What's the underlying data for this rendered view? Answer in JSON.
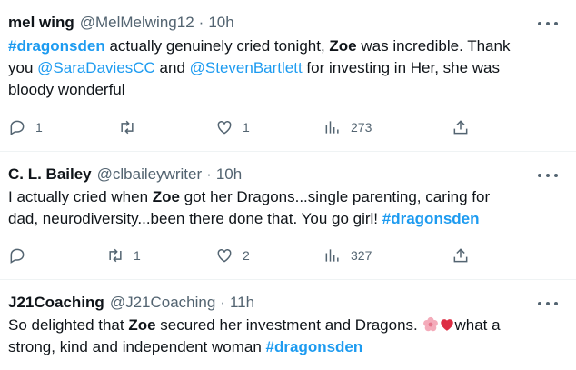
{
  "tweets": [
    {
      "name": "mel wing",
      "handle": "@MelMelwing12",
      "time": "10h",
      "text_parts": [
        "#dragonsden",
        " actually genuinely cried tonight, ",
        "Zoe",
        " was incredible. Thank",
        "you ",
        "@SaraDaviesCC",
        " and ",
        "@StevenBartlett",
        " for investing in Her, she was",
        "bloody wonderful"
      ],
      "replies": "1",
      "retweets": "",
      "likes": "1",
      "views": "273"
    },
    {
      "name": "C. L. Bailey",
      "handle": "@clbaileywriter",
      "time": "10h",
      "text_parts": [
        "I actually cried when ",
        "Zoe",
        " got her Dragons...single parenting, caring for",
        "dad, neurodiversity...been there done that. You go girl! ",
        "#dragonsden"
      ],
      "replies": "",
      "retweets": "1",
      "likes": "2",
      "views": "327"
    },
    {
      "name": "J21Coaching",
      "handle": "@J21Coaching",
      "time": "11h",
      "text_parts": [
        "So delighted that ",
        "Z",
        "oe",
        " secured her investment and Dragons. ",
        "what a",
        "strong, kind and independent woman ",
        "#dragonsden"
      ]
    }
  ],
  "separator": "·",
  "icons": [
    "reply-icon",
    "retweet-icon",
    "like-icon",
    "views-icon",
    "share-icon",
    "more-icon"
  ],
  "colors": {
    "link": "#1d9bf0",
    "muted": "#536471",
    "text": "#0f1419",
    "divider": "#eff3f4"
  }
}
